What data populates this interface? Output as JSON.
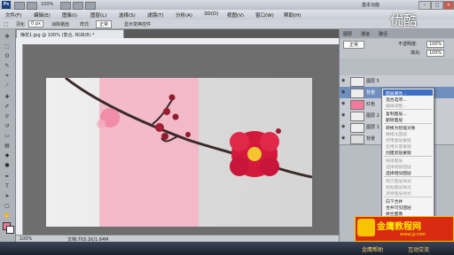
{
  "titlebar": {
    "app_icon": "Ps",
    "zoom": "100%",
    "workspace": "基本功能"
  },
  "menu": [
    "文件(F)",
    "编辑(E)",
    "图像(I)",
    "图层(L)",
    "选择(S)",
    "滤镜(T)",
    "分析(A)",
    "3D(D)",
    "视图(V)",
    "窗口(W)",
    "帮助(H)"
  ],
  "options": {
    "feather_label": "羽化",
    "feather_value": "0 px",
    "antialias": "消除锯齿",
    "style_label": "样式:",
    "style_value": "正常",
    "show_transform": "显示变换控件"
  },
  "document": {
    "tab": "梅花1.jpg @ 100% (复合, RGB/8) *",
    "status": "文档:703.1K/1.64M",
    "zoom": "100%"
  },
  "panel": {
    "tabs": [
      "图层",
      "通道",
      "路径"
    ],
    "blend_mode": "正常",
    "opacity_label": "不透明度:",
    "opacity_value": "100%",
    "fill_label": "填充:",
    "fill_value": "100%",
    "layers": [
      "图层 5",
      "背景",
      "红色",
      "图层 2",
      "图层 1",
      "背景"
    ]
  },
  "context_menu": {
    "items": [
      {
        "label": "图层属性...",
        "disabled": false
      },
      {
        "label": "混合选项...",
        "disabled": false
      },
      {
        "label": "编辑调整...",
        "disabled": true
      },
      {
        "label": "复制图层...",
        "disabled": false
      },
      {
        "label": "删除图层",
        "disabled": false
      },
      {
        "label": "转换为智能对象",
        "disabled": false
      },
      {
        "label": "栅格化图层",
        "disabled": true
      },
      {
        "label": "停用图层蒙版",
        "disabled": true
      },
      {
        "label": "启用矢量蒙版",
        "disabled": true
      },
      {
        "label": "创建剪贴蒙版",
        "disabled": false
      },
      {
        "label": "链接图层",
        "disabled": true
      },
      {
        "label": "选择链接图层",
        "disabled": true
      },
      {
        "label": "选择相似图层",
        "disabled": false
      },
      {
        "label": "拷贝图层样式",
        "disabled": true
      },
      {
        "label": "粘贴图层样式",
        "disabled": true
      },
      {
        "label": "清除图层样式",
        "disabled": true
      },
      {
        "label": "向下合并",
        "disabled": false
      },
      {
        "label": "合并可见图层",
        "disabled": false
      },
      {
        "label": "拼合图像",
        "disabled": false
      }
    ]
  },
  "watermark": {
    "text": "金鹰教程网",
    "url": "www.jy.com",
    "corner_text": "优酷"
  },
  "taskbar": {
    "left": "金鹰帮助",
    "right": "互动交流"
  },
  "colors": {
    "accent": "#e01030",
    "pink_overlay": "#f6a9bd",
    "watermark_bg": "#d92b12"
  }
}
